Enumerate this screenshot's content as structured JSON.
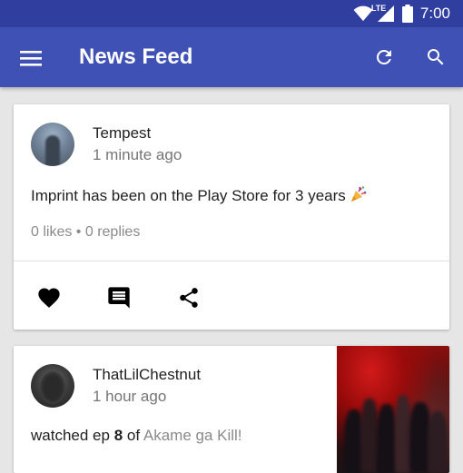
{
  "status_bar": {
    "time": "7:00",
    "network": "LTE",
    "icons": [
      "wifi-icon",
      "signal-icon",
      "battery-icon"
    ]
  },
  "app_bar": {
    "title": "News Feed",
    "icons": [
      "menu-icon",
      "refresh-icon",
      "search-icon"
    ],
    "color": "#3f51b5",
    "status_color": "#303f9f"
  },
  "feed": [
    {
      "username": "Tempest",
      "time_ago": "1 minute ago",
      "text": "Imprint has been on the Play Store for 3 years",
      "emoji": "party-popper-icon",
      "stats": "0 likes • 0 replies",
      "actions": [
        "heart-icon",
        "comment-icon",
        "share-icon"
      ]
    },
    {
      "username": "ThatLilChestnut",
      "time_ago": "1 hour ago",
      "text_prefix": "watched ep",
      "episode": "8",
      "text_of": "of",
      "anime": "Akame ga Kill!",
      "thumbnail": "anime-cover-image"
    }
  ]
}
